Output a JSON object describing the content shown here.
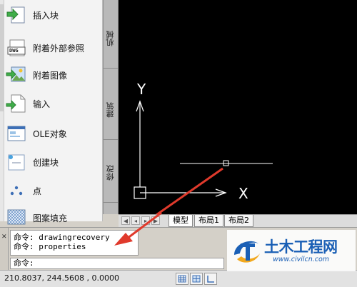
{
  "palette": {
    "items": [
      {
        "label": "插入块",
        "icon": "insert-block-icon"
      },
      {
        "label": "附着外部参照",
        "icon": "dwg-xref-icon",
        "badge": "DWG"
      },
      {
        "label": "附着图像",
        "icon": "attach-image-icon"
      },
      {
        "label": "输入",
        "icon": "import-icon"
      },
      {
        "label": "OLE对象",
        "icon": "ole-object-icon"
      },
      {
        "label": "创建块",
        "icon": "create-block-icon"
      },
      {
        "label": "点",
        "icon": "point-icon"
      },
      {
        "label": "图案填充",
        "icon": "hatch-icon"
      }
    ],
    "tabs": [
      "机械",
      "建筑",
      "修改"
    ]
  },
  "canvas": {
    "background": "#000000",
    "ucs_y_label": "Y",
    "ucs_x_label": "X",
    "arrow_color": "#e03a2c"
  },
  "layout_tabs": [
    "模型",
    "布局1",
    "布局2"
  ],
  "command": {
    "history": [
      "命令: drawingrecovery",
      "命令: properties"
    ],
    "prompt": "命令:"
  },
  "status": {
    "coords": "210.8037,  244.5608 ,  0.0000"
  },
  "watermark": {
    "name": "土木工程网",
    "url": "www.civilcn.com",
    "color": "#1a5fb5"
  }
}
